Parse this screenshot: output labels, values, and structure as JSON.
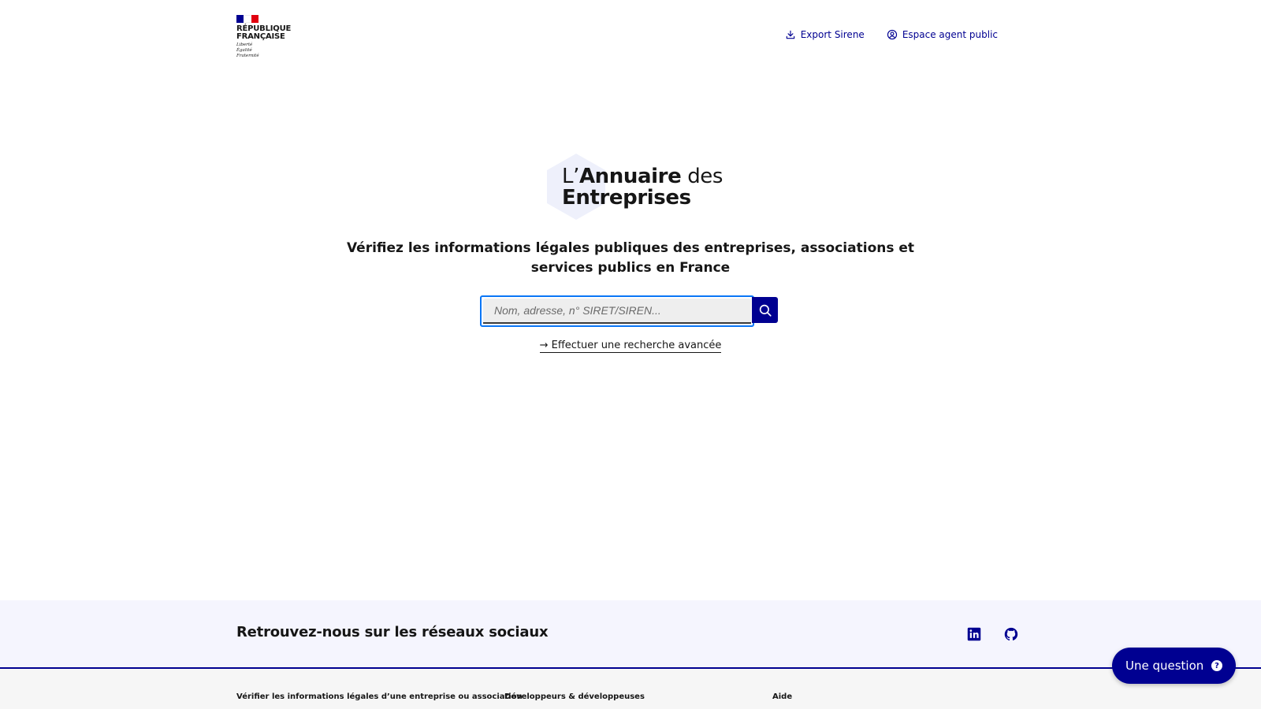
{
  "header": {
    "gov_name_line1": "RÉPUBLIQUE",
    "gov_name_line2": "FRANÇAISE",
    "motto": [
      "Liberté",
      "Égalité",
      "Fraternité"
    ],
    "links": [
      {
        "label": "Export Sirene",
        "icon": "download-icon"
      },
      {
        "label": "Espace agent public",
        "icon": "user-circle-icon"
      }
    ]
  },
  "brand": {
    "prefix": "L’",
    "strong": "Annuaire",
    "suffix": " des",
    "line2": "Entreprises"
  },
  "tagline": "Vérifiez les informations légales publiques des entreprises, associations et services publics en France",
  "search": {
    "placeholder": "Nom, adresse, n° SIRET/SIREN...",
    "value": ""
  },
  "advanced_link": "→ Effectuer une recherche avancée",
  "social": {
    "title": "Retrouvez-nous sur les réseaux sociaux",
    "icons": [
      "linkedin-icon",
      "github-icon"
    ]
  },
  "footer": {
    "columns": [
      "Vérifier les informations légales d’une entreprise ou association",
      "Développeurs & développeuses",
      "Aide"
    ]
  },
  "question_button": {
    "label": "Une question",
    "icon": "question-icon"
  },
  "colors": {
    "primary": "#000091",
    "focus": "#0a76f6",
    "social_bg": "#f5f5fe",
    "hexagon": "#eef0fb"
  }
}
